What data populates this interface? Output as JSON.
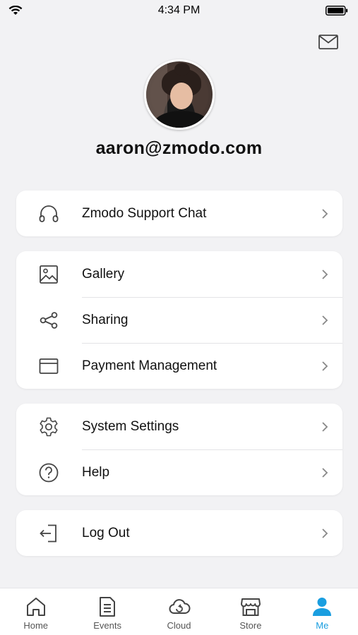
{
  "status_bar": {
    "time": "4:34 PM"
  },
  "header": {
    "mail_icon": "mail-icon"
  },
  "profile": {
    "email": "aaron@zmodo.com"
  },
  "menu": {
    "support": {
      "label": "Zmodo Support Chat",
      "icon": "headset-icon"
    },
    "gallery": {
      "label": "Gallery",
      "icon": "image-icon"
    },
    "sharing": {
      "label": "Sharing",
      "icon": "share-icon"
    },
    "payment": {
      "label": "Payment Management",
      "icon": "card-icon"
    },
    "settings": {
      "label": "System Settings",
      "icon": "gear-icon"
    },
    "help": {
      "label": "Help",
      "icon": "help-icon"
    },
    "logout": {
      "label": "Log Out",
      "icon": "logout-icon"
    }
  },
  "tabs": [
    {
      "label": "Home",
      "icon": "home-icon"
    },
    {
      "label": "Events",
      "icon": "document-icon"
    },
    {
      "label": "Cloud",
      "icon": "cloud-icon"
    },
    {
      "label": "Store",
      "icon": "store-icon"
    },
    {
      "label": "Me",
      "icon": "person-icon",
      "active": true
    }
  ],
  "colors": {
    "accent": "#1a9ee0",
    "background": "#f2f2f4",
    "card": "#ffffff"
  }
}
